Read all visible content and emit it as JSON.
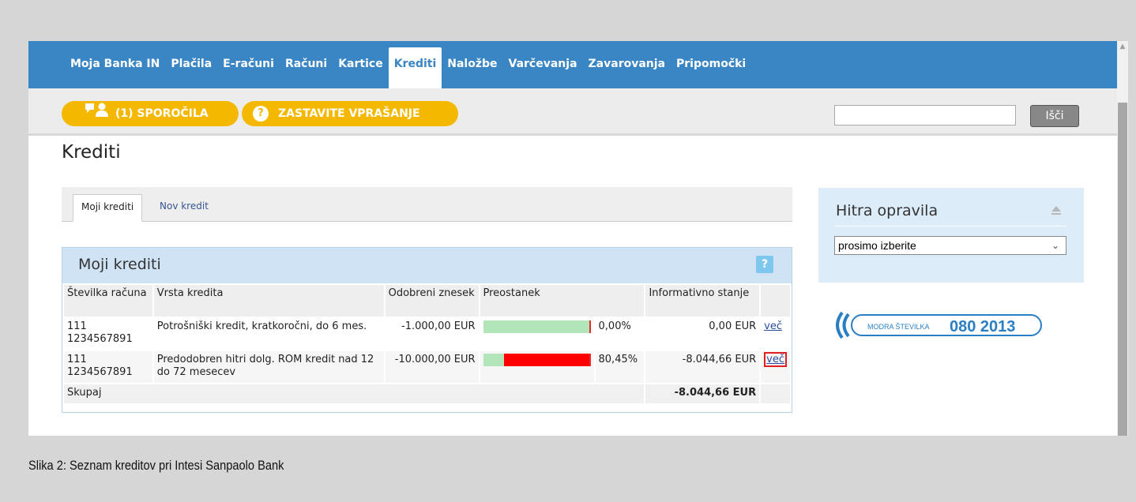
{
  "nav": {
    "items": [
      {
        "label": "Moja Banka IN",
        "active": false
      },
      {
        "label": "Plačila",
        "active": false
      },
      {
        "label": "E-računi",
        "active": false
      },
      {
        "label": "Računi",
        "active": false
      },
      {
        "label": "Kartice",
        "active": false
      },
      {
        "label": "Krediti",
        "active": true
      },
      {
        "label": "Naložbe",
        "active": false
      },
      {
        "label": "Varčevanja",
        "active": false
      },
      {
        "label": "Zavarovanja",
        "active": false
      },
      {
        "label": "Pripomočki",
        "active": false
      }
    ]
  },
  "toolbar": {
    "messages_label": "(1) SPOROČILA",
    "ask_label": "ZASTAVITE VPRAŠANJE",
    "search_value": "",
    "search_button": "Išči",
    "accent_color": "#f5b800"
  },
  "page": {
    "title": "Krediti"
  },
  "tabs": [
    {
      "label": "Moji krediti",
      "active": true
    },
    {
      "label": "Nov kredit",
      "active": false
    }
  ],
  "loans": {
    "title": "Moji krediti",
    "help": "?",
    "columns": [
      "Številka računa",
      "Vrsta kredita",
      "Odobreni znesek",
      "Preostanek",
      "Informativno stanje"
    ],
    "rows": [
      {
        "account_line1": "111",
        "account_line2": "1234567891",
        "type": "Potrošniški kredit, kratkoročni, do 6 mes.",
        "approved": "-1.000,00 EUR",
        "remaining_fraction": 0.0,
        "remaining_pct": "0,00%",
        "balance": "0,00 EUR",
        "more": "več"
      },
      {
        "account_line1": "111",
        "account_line2": "1234567891",
        "type": "Predodobren hitri dolg. ROM kredit nad 12 do 72 mesecev",
        "approved": "-10.000,00 EUR",
        "remaining_fraction": 0.8045,
        "remaining_pct": "80,45%",
        "balance": "-8.044,66 EUR",
        "more": "več"
      }
    ],
    "total_label": "Skupaj",
    "total_value": "-8.044,66 EUR"
  },
  "quick": {
    "title": "Hitra opravila",
    "select_value": "prosimo izberite"
  },
  "hotline": {
    "label": "MODRA ŠTEVILKA",
    "number": "080 2013"
  },
  "caption": "Slika 2: Seznam kreditov pri Intesi Sanpaolo Bank"
}
